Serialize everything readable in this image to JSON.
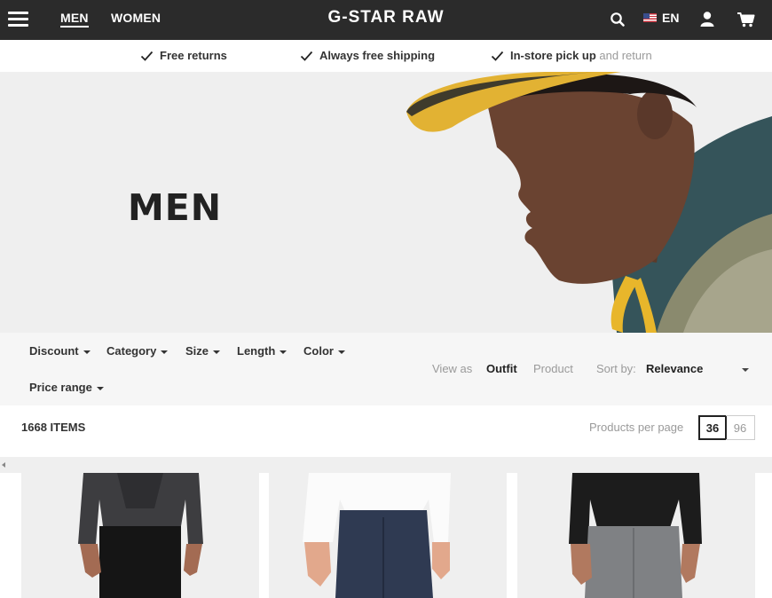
{
  "nav": {
    "links": [
      {
        "label": "MEN",
        "active": true
      },
      {
        "label": "WOMEN",
        "active": false
      }
    ],
    "brand": "G-STAR RAW",
    "language": "EN",
    "icons": [
      "menu-icon",
      "search-icon",
      "us-flag-icon",
      "account-icon",
      "cart-icon"
    ]
  },
  "benefits": [
    {
      "bold": "Free returns",
      "light": ""
    },
    {
      "bold": "Always free shipping",
      "light": ""
    },
    {
      "bold": "In-store pick up",
      "light": " and return"
    }
  ],
  "hero": {
    "title": "MEN"
  },
  "filters": {
    "items": [
      "Discount",
      "Category",
      "Size",
      "Length",
      "Color",
      "Price range"
    ],
    "view_as_label": "View as",
    "view_options": [
      {
        "label": "Outfit",
        "active": true
      },
      {
        "label": "Product",
        "active": false
      }
    ],
    "sort_label": "Sort by:",
    "sort_value": "Relevance"
  },
  "listing": {
    "item_count": "1668 ITEMS",
    "per_page_label": "Products per page",
    "per_page_options": [
      {
        "label": "36",
        "selected": true
      },
      {
        "label": "96",
        "selected": false
      }
    ]
  },
  "products": [
    {
      "name": "denim-jacket-outfit"
    },
    {
      "name": "white-top-jeans-outfit"
    },
    {
      "name": "black-sweater-grey-jeans-outfit"
    }
  ],
  "colors": {
    "nav_bg": "#2b2b2b",
    "hero_bg": "#efefef",
    "filter_bg": "#f6f6f6",
    "muted_text": "#9a9a9a"
  }
}
